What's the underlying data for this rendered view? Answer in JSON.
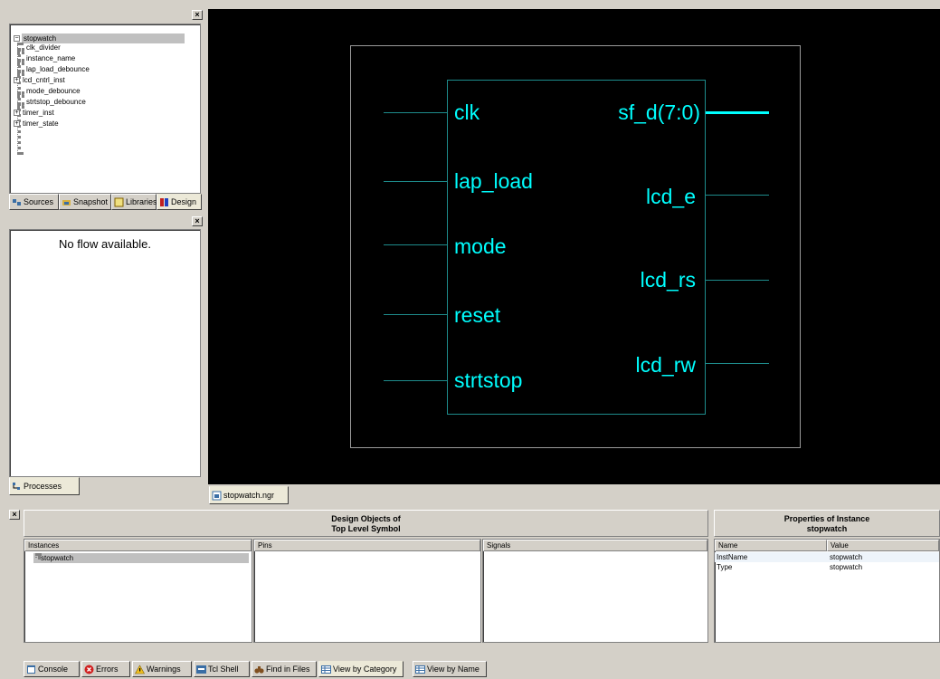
{
  "sources_panel": {
    "tree": {
      "root": "stopwatch",
      "children": [
        {
          "label": "clk_divider",
          "expandable": false
        },
        {
          "label": "instance_name",
          "expandable": false
        },
        {
          "label": "lap_load_debounce",
          "expandable": false
        },
        {
          "label": "lcd_cntrl_inst",
          "expandable": true
        },
        {
          "label": "mode_debounce",
          "expandable": false
        },
        {
          "label": "strtstop_debounce",
          "expandable": false
        },
        {
          "label": "timer_inst",
          "expandable": true
        },
        {
          "label": "timer_state",
          "expandable": true
        }
      ]
    },
    "tabs": [
      {
        "label": "Sources"
      },
      {
        "label": "Snapshot"
      },
      {
        "label": "Libraries"
      },
      {
        "label": "Design"
      }
    ]
  },
  "processes_panel": {
    "message": "No flow available.",
    "tab_label": "Processes"
  },
  "schematic": {
    "tab_label": "stopwatch.ngr",
    "inputs": [
      "clk",
      "lap_load",
      "mode",
      "reset",
      "strtstop"
    ],
    "outputs": [
      "sf_d(7:0)",
      "lcd_e",
      "lcd_rs",
      "lcd_rw"
    ]
  },
  "design_objects": {
    "title_line1": "Design Objects of",
    "title_line2": "Top Level Symbol",
    "columns": [
      "Instances",
      "Pins",
      "Signals"
    ],
    "instances": [
      "stopwatch"
    ]
  },
  "properties": {
    "title_line1": "Properties of Instance",
    "title_line2": "stopwatch",
    "columns": [
      "Name",
      "Value"
    ],
    "rows": [
      {
        "name": "InstName",
        "value": "stopwatch"
      },
      {
        "name": "Type",
        "value": "stopwatch"
      }
    ]
  },
  "bottom_tabs": [
    {
      "label": "Console",
      "icon": "console-icon"
    },
    {
      "label": "Errors",
      "icon": "error-icon"
    },
    {
      "label": "Warnings",
      "icon": "warning-icon"
    },
    {
      "label": "Tcl Shell",
      "icon": "tcl-icon"
    },
    {
      "label": "Find in Files",
      "icon": "binoculars-icon"
    },
    {
      "label": "View by Category",
      "icon": "table-icon"
    },
    {
      "label": "View by Name",
      "icon": "table-icon"
    }
  ],
  "colors": {
    "schematic_bg": "#000000",
    "pin_text": "#00ffff",
    "wire": "#1e8c8c",
    "frame": "#9a9a9a"
  }
}
